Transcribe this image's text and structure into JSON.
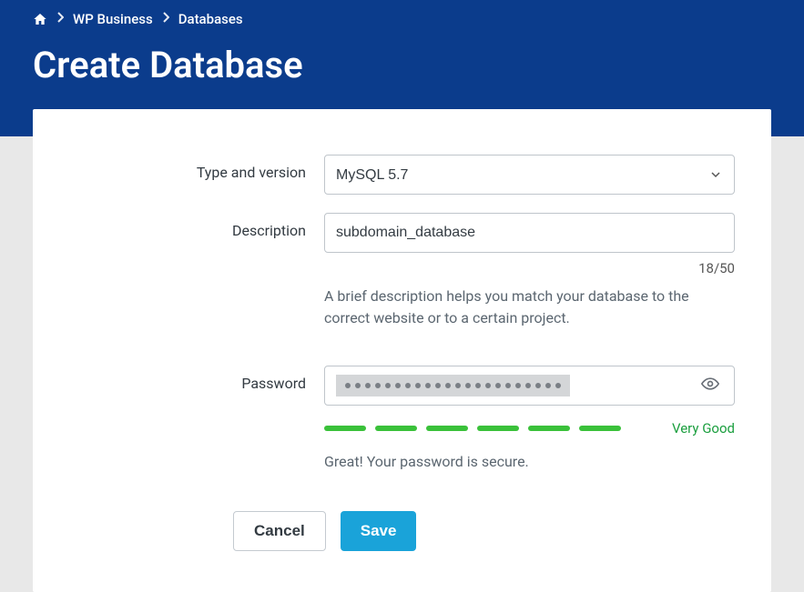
{
  "breadcrumb": {
    "items": [
      "WP Business",
      "Databases"
    ]
  },
  "page": {
    "title": "Create Database"
  },
  "form": {
    "type_label": "Type and version",
    "type_value": "MySQL 5.7",
    "description_label": "Description",
    "description_value": "subdomain_database",
    "description_counter": "18/50",
    "description_helper": "A brief description helps you match your database to the correct website or to a certain project.",
    "password_label": "Password",
    "password_strength_label": "Very Good",
    "password_message": "Great! Your password is secure."
  },
  "buttons": {
    "cancel": "Cancel",
    "save": "Save"
  }
}
